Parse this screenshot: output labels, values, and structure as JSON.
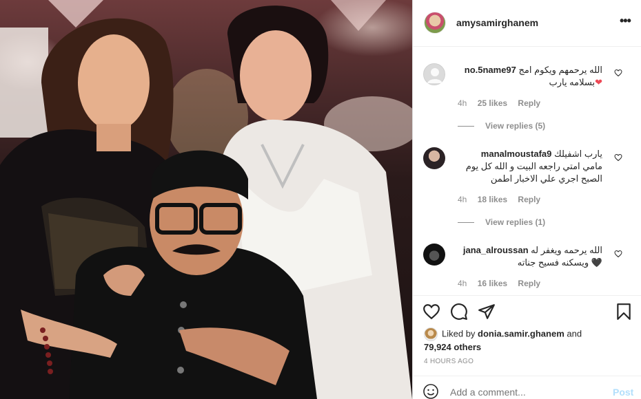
{
  "photo": {
    "alt_icon": "photo"
  },
  "header": {
    "username": "amysamirghanem",
    "more_icon": "more-horizontal-icon"
  },
  "comments": [
    {
      "username": "no.5name97",
      "text": "الله يرحمهم ويكوم امج ",
      "text2": "بسلامه يارب",
      "emoji": "❤",
      "time": "4h",
      "likes": "25 likes",
      "reply": "Reply",
      "view_replies": "View replies (5)"
    },
    {
      "username": "manalmoustafa9",
      "text": "يارب اشفيلك",
      "text2": "مامي امتي راجعه البيت و الله كل يوم",
      "text3": "الصبح اجري علي الاخبار اطمن",
      "time": "4h",
      "likes": "18 likes",
      "reply": "Reply",
      "view_replies": "View replies (1)"
    },
    {
      "username": "jana_alroussan",
      "text": "الله يرحمه ويغفر له",
      "text2": "ويسكنه فسيح جناته",
      "emoji": "🖤",
      "time": "4h",
      "likes": "16 likes",
      "reply": "Reply"
    }
  ],
  "footer": {
    "liked_prefix": "Liked by ",
    "liked_user": "donia.samir.ghanem",
    "liked_and": " and",
    "liked_others": "79,924 others",
    "time_ago": "4 HOURS AGO",
    "comment_placeholder": "Add a comment...",
    "post_label": "Post"
  },
  "colors": {
    "link_blue": "#b2dffc",
    "muted": "#8e8e8e",
    "text": "#262626",
    "heart_red": "#ed4956"
  }
}
